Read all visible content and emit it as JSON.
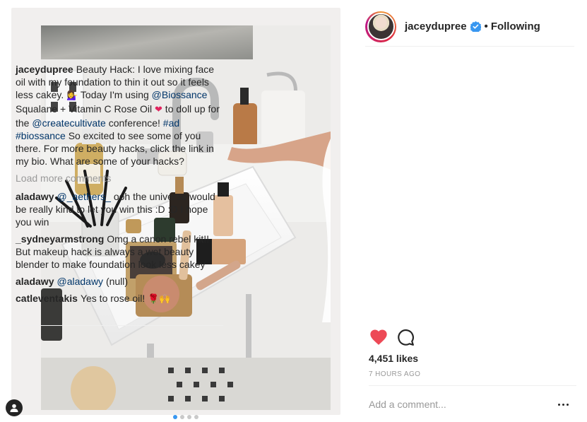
{
  "post": {
    "username": "jaceydupree",
    "separator": "•",
    "follow_status": "Following",
    "likes": "4,451 likes",
    "time_ago": "7 HOURS AGO",
    "add_comment_placeholder": "Add a comment...",
    "load_more": "Load more comments",
    "photo_count": 4,
    "active_photo": 1
  },
  "caption": {
    "user": "jaceydupree",
    "t1": "Beauty Hack: I love mixing face oil with my foundation to thin it out so it feels less cakey. ",
    "e1": "💁‍♀",
    "t2": " Today I'm using ",
    "l1": "@Biossance",
    "t3": " Squalane + Vitamin C Rose Oil ",
    "e2": "❤",
    "t4": " to doll up for the ",
    "l2": "@createcultivate",
    "t5": " conference! ",
    "l3": "#ad",
    "t6": " ",
    "l4": "#biossance",
    "t7": " So excited to see some of you there. For more beauty hacks, click the link in my bio. What are some of your hacks?"
  },
  "comments": [
    {
      "user": "aladawy",
      "link": "@_aethers_",
      "text": " ooh the universe would be really kind to let you win this :D :D I hope you win"
    },
    {
      "user": "_sydneyarmstrong",
      "text": "Omg a canon rebel kit!! But makeup hack is always a wet beauty blender to make foundation look less cakey"
    },
    {
      "user": "aladawy",
      "link": "@aladawy",
      "text": " (null)"
    },
    {
      "user": "catleventakis",
      "text": "Yes to rose oil! ",
      "emoji": "🌹🙌"
    }
  ],
  "colors": {
    "like_red": "#ed4956",
    "link_blue": "#003569",
    "verified_blue": "#3897f0",
    "muted_text": "#999999"
  },
  "icons": {
    "verified": "verified-badge-icon",
    "like": "heart-icon",
    "comment": "comment-bubble-icon",
    "tag": "user-tag-icon",
    "more": "more-options-icon"
  }
}
